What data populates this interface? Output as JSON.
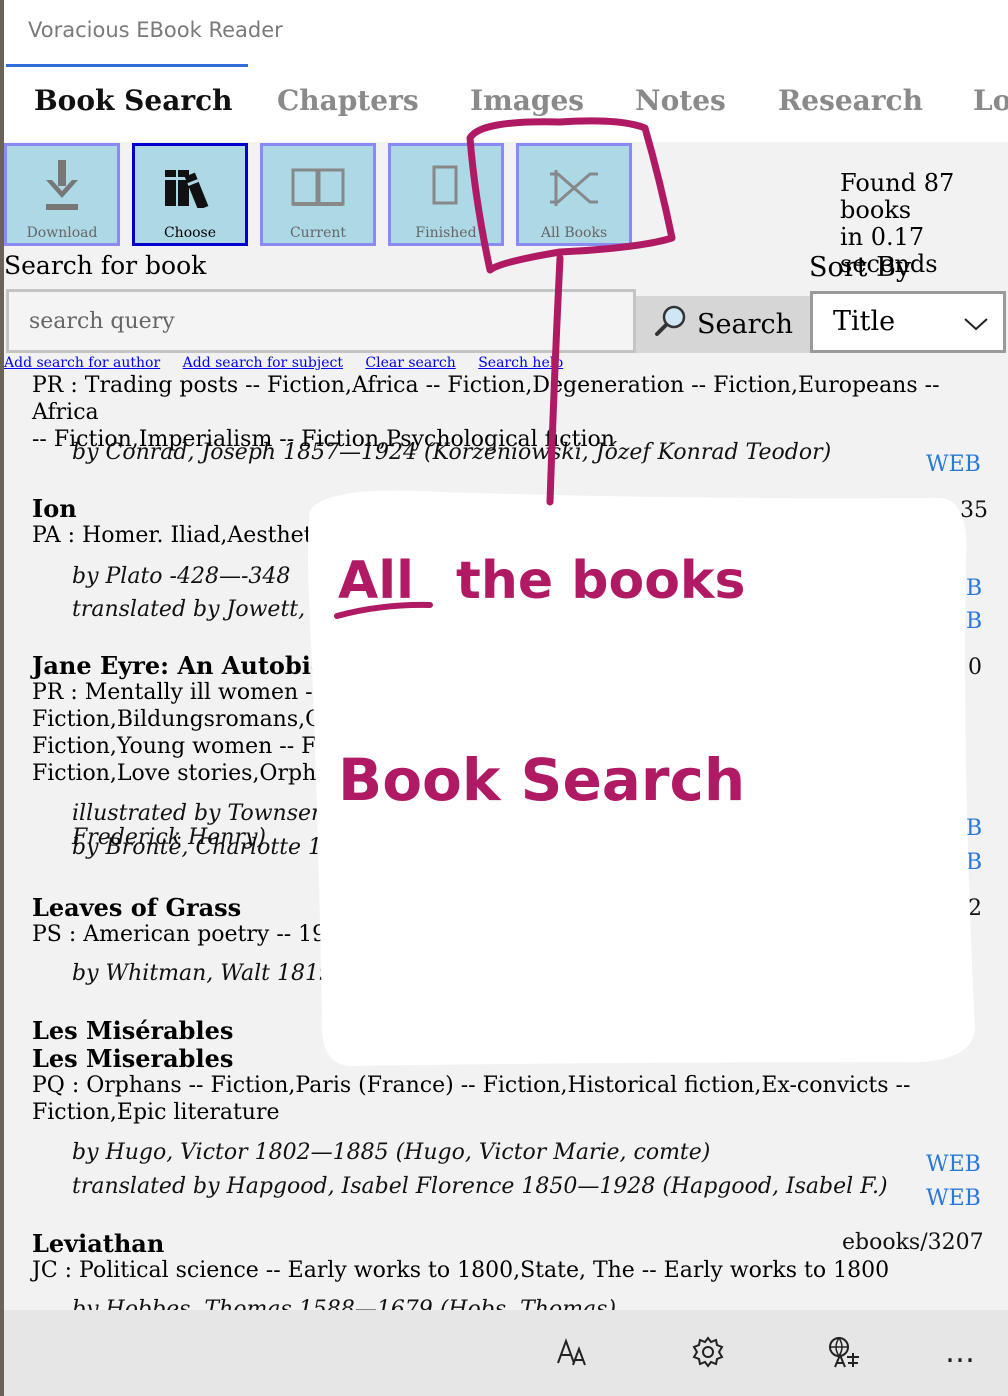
{
  "window": {
    "title": "Voracious EBook Reader"
  },
  "tabs": [
    "Book Search",
    "Chapters",
    "Images",
    "Notes",
    "Research",
    "Lo"
  ],
  "toolbar": {
    "download": "Download",
    "choose": "Choose",
    "current": "Current",
    "finished": "Finished",
    "all_books": "All Books"
  },
  "status": {
    "line1": "Found 87 books",
    "line2": "in 0.17 seconds"
  },
  "search": {
    "label": "Search for book",
    "placeholder": "search query",
    "button": "Search",
    "sort_label": "Sort By",
    "sort_value": "Title"
  },
  "links": [
    "Add search for author",
    "Add search for subject",
    "Clear search",
    "Search help"
  ],
  "results": {
    "r0": {
      "subject_a": "PR : Trading posts -- Fiction,Africa -- Fiction,Degeneration -- Fiction,Europeans -- Africa",
      "subject_b": "-- Fiction,Imperialism -- Fiction,Psychological fiction",
      "author": "by Conrad, Joseph 1857—1924 (Korzeniowski, Józef Konrad Teodor)",
      "web": "WEB"
    },
    "r1": {
      "title": "Ion",
      "subject": "PA : Homer. Iliad,Aesthet",
      "author": "by Plato -428—-348",
      "translator": "translated by Jowett,",
      "ebook": "35",
      "web1": "B",
      "web2": "B"
    },
    "r2": {
      "title": "Jane Eyre: An Autobio",
      "subject_a": "PR : Mentally ill women --",
      "subject_b": "Fiction,Bildungsromans,G",
      "subject_c": "Fiction,Young women -- F",
      "subject_d": "Fiction,Love stories,Orpha",
      "illus": "illustrated by Townsen",
      "illus2": "Frederick Henry)",
      "author": "by Brontë, Charlotte 18",
      "ebook": "0",
      "web1": "B",
      "web2": "B"
    },
    "r3": {
      "title": "Leaves of Grass",
      "subject": "PS : American poetry -- 19t",
      "author": "by Whitman, Walt 1819",
      "ebook": "2"
    },
    "r4": {
      "title": "Les Misérables",
      "title2": "Les Miserables",
      "subject_a": "PQ : Orphans -- Fiction,Paris (France) -- Fiction,Historical fiction,Ex-convicts --",
      "subject_b": "Fiction,Epic literature",
      "author": "by Hugo, Victor 1802—1885 (Hugo, Victor Marie, comte)",
      "translator": "translated by Hapgood, Isabel Florence 1850—1928 (Hapgood, Isabel F.)",
      "web1": "WEB",
      "web2": "WEB"
    },
    "r5": {
      "title": "Leviathan",
      "ebook": "ebooks/3207",
      "subject": "JC : Political science -- Early works to 1800,State, The -- Early works to 1800",
      "author": "by Hobbes, Thomas 1588—1679 (Hobs, Thomas)"
    }
  },
  "bottom_bar": {
    "more": "…"
  },
  "annotation": {
    "line1_a": "All",
    "line1_b": "the books",
    "line2": "Book Search",
    "color": "#b01a64"
  }
}
